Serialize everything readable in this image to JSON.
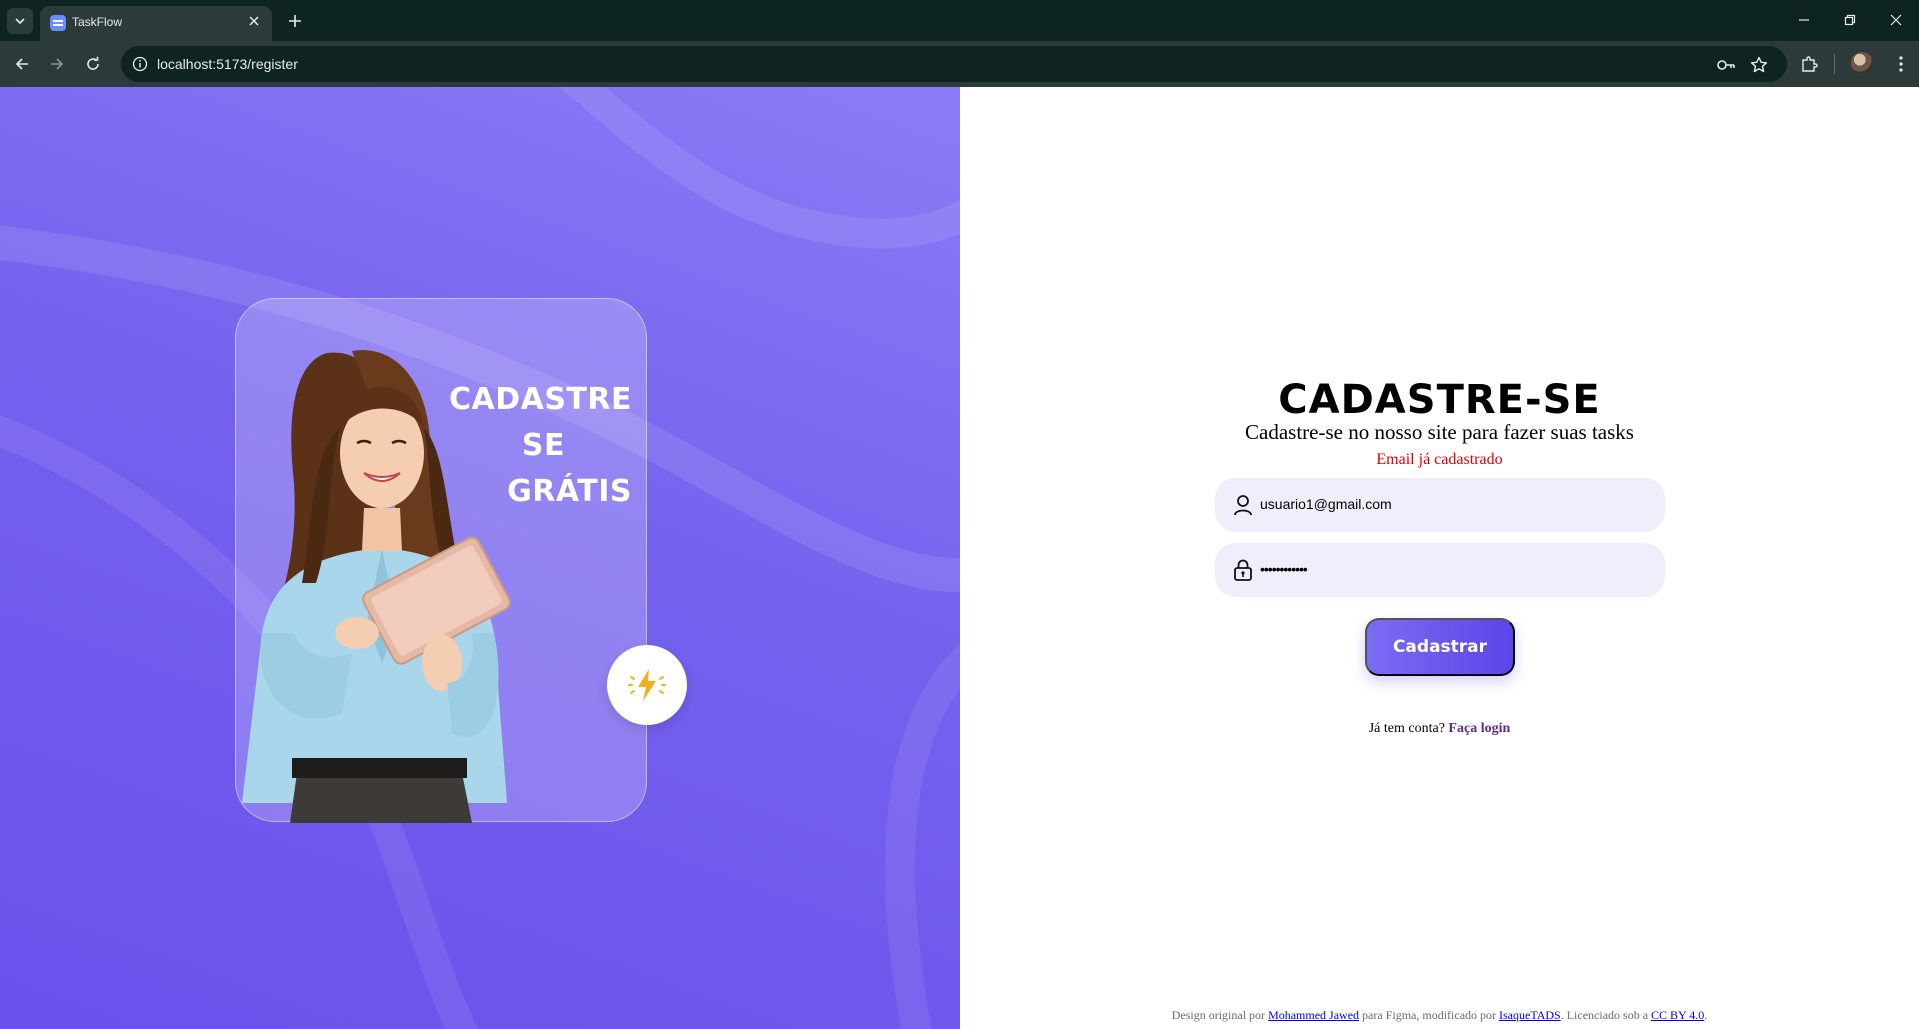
{
  "browser": {
    "tab_title": "TaskFlow",
    "url": "localhost:5173/register"
  },
  "illustration": {
    "title_lines": [
      "CADASTRE",
      "SE",
      "GRÁTIS"
    ],
    "badge_icon": "lightning-icon"
  },
  "form": {
    "title": "CADASTRE-SE",
    "subtitle": "Cadastre-se no nosso site para fazer suas tasks",
    "error": "Email já cadastrado",
    "email_value": "usuario1@gmail.com",
    "password_value": "••••••••••••",
    "submit_label": "Cadastrar",
    "login_prompt": "Já tem conta?",
    "login_link": "Faça login"
  },
  "footer": {
    "prefix": "Design original por",
    "author": "Mohammed Jawed",
    "middle": "para Figma, modificado por",
    "modifier": "IsaqueTADS",
    "license_prefix": ". Licenciado sob a",
    "license": "CC BY 4.0",
    "suffix": "."
  },
  "colors": {
    "accent": "#6a50ec",
    "error": "#e00000",
    "field_bg": "#efeefb",
    "link": "#5a2c8c"
  }
}
